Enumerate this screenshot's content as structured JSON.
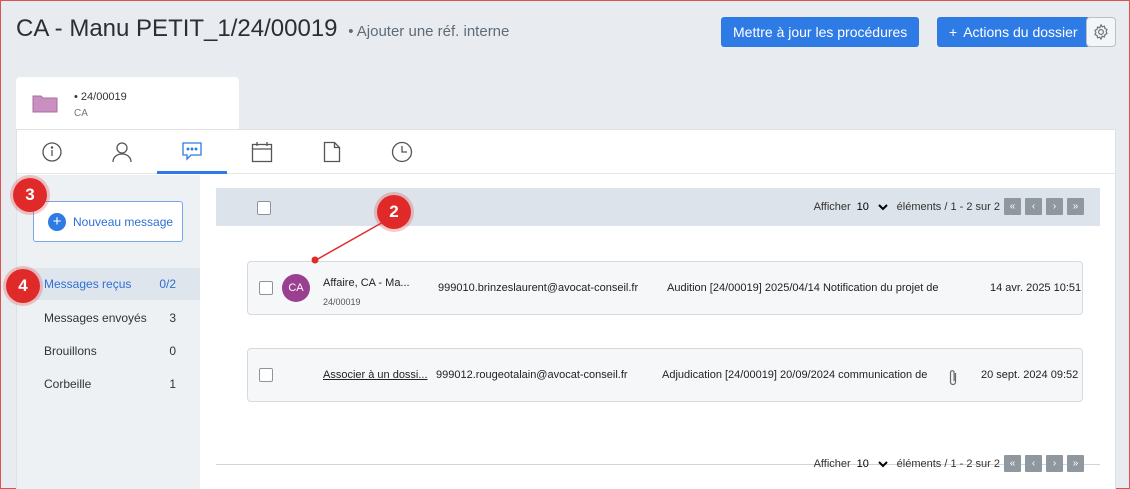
{
  "header": {
    "title": "CA - Manu PETIT_1/24/00019",
    "subtitle": "• Ajouter une réf. interne",
    "update_button": "Mettre à jour les procédures",
    "actions_button": "Actions du dossier",
    "actions_plus": "+"
  },
  "dossier": {
    "number": "• 24/00019",
    "category": "CA"
  },
  "tabs": [
    {
      "icon": "info-icon"
    },
    {
      "icon": "user-icon"
    },
    {
      "icon": "chat-icon",
      "active": true
    },
    {
      "icon": "calendar-icon"
    },
    {
      "icon": "document-icon"
    },
    {
      "icon": "clock-icon"
    }
  ],
  "sidebar": {
    "new_message": "Nouveau message",
    "folders": [
      {
        "label": "Messages reçus",
        "count": "0/2"
      },
      {
        "label": "Messages envoyés",
        "count": "3"
      },
      {
        "label": "Brouillons",
        "count": "0"
      },
      {
        "label": "Corbeille",
        "count": "1"
      }
    ]
  },
  "pager": {
    "show": "Afficher",
    "page_size": "10",
    "elements": "éléments / 1 - 2 sur 2",
    "first": "«",
    "prev": "‹",
    "next": "›",
    "last": "»"
  },
  "messages": [
    {
      "avatar": "CA",
      "sender": "Affaire, CA - Ma...",
      "ref": "24/00019",
      "email": "999010.brinzeslaurent@avocat-conseil.fr",
      "subject": "Audition [24/00019] 2025/04/14 Notification du projet de",
      "date": "14 avr. 2025 10:51"
    },
    {
      "link": "Associer à un dossi...",
      "email": "999012.rougeotalain@avocat-conseil.fr",
      "subject": "Adjudication [24/00019] 20/09/2024 communication de",
      "date": "20 sept. 2024 09:52"
    }
  ],
  "markers": [
    "2",
    "3",
    "4"
  ],
  "colors": {
    "primary": "#2f7be5",
    "avatar": "#9b3f91",
    "marker": "#e02a2a",
    "folder_icon": "#c98fc0"
  }
}
